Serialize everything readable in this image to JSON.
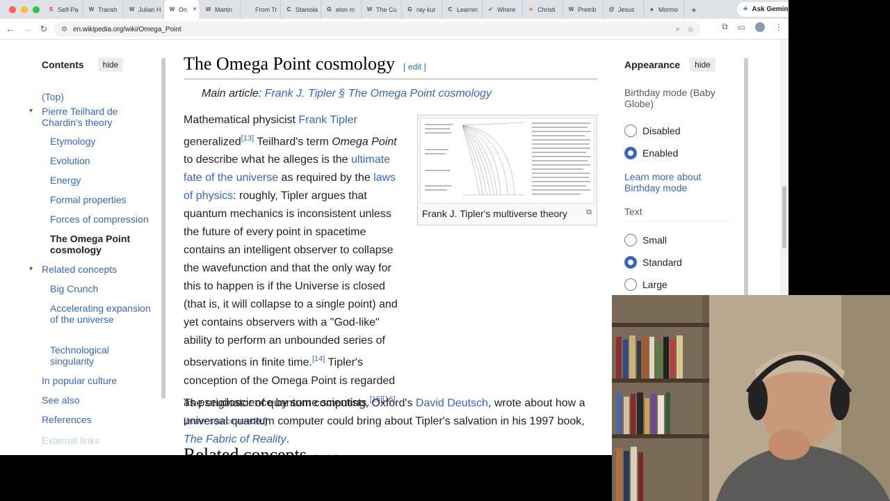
{
  "browser": {
    "tabs": [
      {
        "label": "Self-Pa",
        "icon_color": "#d93025",
        "icon": "S"
      },
      {
        "label": "Transh",
        "icon_color": "#555",
        "icon": "W"
      },
      {
        "label": "Julian H",
        "icon_color": "#555",
        "icon": "W"
      },
      {
        "label": "On",
        "icon_color": "#555",
        "icon": "W",
        "active": true
      },
      {
        "label": "Martin",
        "icon_color": "#555",
        "icon": "W"
      },
      {
        "label": "From Tr",
        "icon_color": "#888",
        "icon": ""
      },
      {
        "label": "Stanisła",
        "icon_color": "#3c4043",
        "icon": "C"
      },
      {
        "label": "elon m",
        "icon_color": "#3c4043",
        "icon": "G"
      },
      {
        "label": "The Cu",
        "icon_color": "#555",
        "icon": "W"
      },
      {
        "label": "ray kur",
        "icon_color": "#3c4043",
        "icon": "G"
      },
      {
        "label": "Learnin",
        "icon_color": "#3c4043",
        "icon": "C"
      },
      {
        "label": "Where",
        "icon_color": "#3c4043",
        "icon": "✓"
      },
      {
        "label": "Christi",
        "icon_color": "#e8710a",
        "icon": "✦"
      },
      {
        "label": "Pretrib",
        "icon_color": "#555",
        "icon": "W"
      },
      {
        "label": "Jesus",
        "icon_color": "#3c4043",
        "icon": "@"
      },
      {
        "label": "Mormo",
        "icon_color": "#3c4043",
        "icon": "●"
      }
    ],
    "ask_gemini": "Ask Gemini",
    "url": "en.wikipedia.org/wiki/Omega_Point"
  },
  "toc": {
    "title": "Contents",
    "hide": "hide",
    "items": [
      {
        "label": "(Top)",
        "level": 0
      },
      {
        "label": "Pierre Teilhard de Chardin's theory",
        "level": 0,
        "expanded": true
      },
      {
        "label": "Etymology",
        "level": 1
      },
      {
        "label": "Evolution",
        "level": 1
      },
      {
        "label": "Energy",
        "level": 1
      },
      {
        "label": "Formal properties",
        "level": 1
      },
      {
        "label": "Forces of compression",
        "level": 1
      },
      {
        "label": "The Omega Point cosmology",
        "level": 1,
        "current": true
      },
      {
        "label": "Related concepts",
        "level": 0,
        "expanded": true
      },
      {
        "label": "Big Crunch",
        "level": 1
      },
      {
        "label": "Accelerating expansion of the universe",
        "level": 1
      },
      {
        "label": "Technological singularity",
        "level": 1
      },
      {
        "label": "In popular culture",
        "level": 0
      },
      {
        "label": "See also",
        "level": 0
      },
      {
        "label": "References",
        "level": 0
      },
      {
        "label": "External links",
        "level": 0
      }
    ]
  },
  "article": {
    "heading": "The Omega Point cosmology",
    "edit": "edit",
    "main_article_prefix": "Main article: ",
    "main_article_link": "Frank J. Tipler § The Omega Point cosmology",
    "p1": {
      "t1": "Mathematical physicist ",
      "l1": "Frank Tipler",
      "t2": "generalized",
      "ref1": "[13]",
      "t3": " Teilhard's term ",
      "em1": "Omega Point",
      "t4": "to describe what he alleges is the ",
      "l2": "ultimate fate of the universe",
      "t5": " as required by the ",
      "l3": "laws of physics",
      "t6": ": roughly, Tipler argues that quantum mechanics is inconsistent unless the future of every point in spacetime contains an intelligent observer to collapse the wavefunction and that the only way for this to happen is if the Universe is closed (that is, it will collapse to a single point) and yet contains observers with a \"God-like\" ability to perform an unbounded series of observations in finite time.",
      "ref2": "[14]",
      "t7": " Tipler's conception of the Omega Point is regarded as pseudoscience by some scientists.",
      "ref3": "[15][16]",
      "t8": " [",
      "needed": "better source needed",
      "t9": "]"
    },
    "p2": {
      "t1": "The originator of quantum computing, Oxford's ",
      "l1": "David Deutsch",
      "t2": ", wrote about how a universal quantum computer could bring about Tipler's salvation in his 1997 book, ",
      "l2": "The Fabric of Reality",
      "t3": "."
    },
    "figure_caption": "Frank J. Tipler's multiverse theory",
    "next_heading": "Related concepts"
  },
  "appearance": {
    "title": "Appearance",
    "hide": "hide",
    "birthday_label": "Birthday mode (Baby Globe)",
    "birthday_options": [
      "Disabled",
      "Enabled"
    ],
    "birthday_selected": "Enabled",
    "learn_more": "Learn more about Birthday mode",
    "text_label": "Text",
    "text_options": [
      "Small",
      "Standard",
      "Large"
    ],
    "text_selected": "Standard"
  }
}
